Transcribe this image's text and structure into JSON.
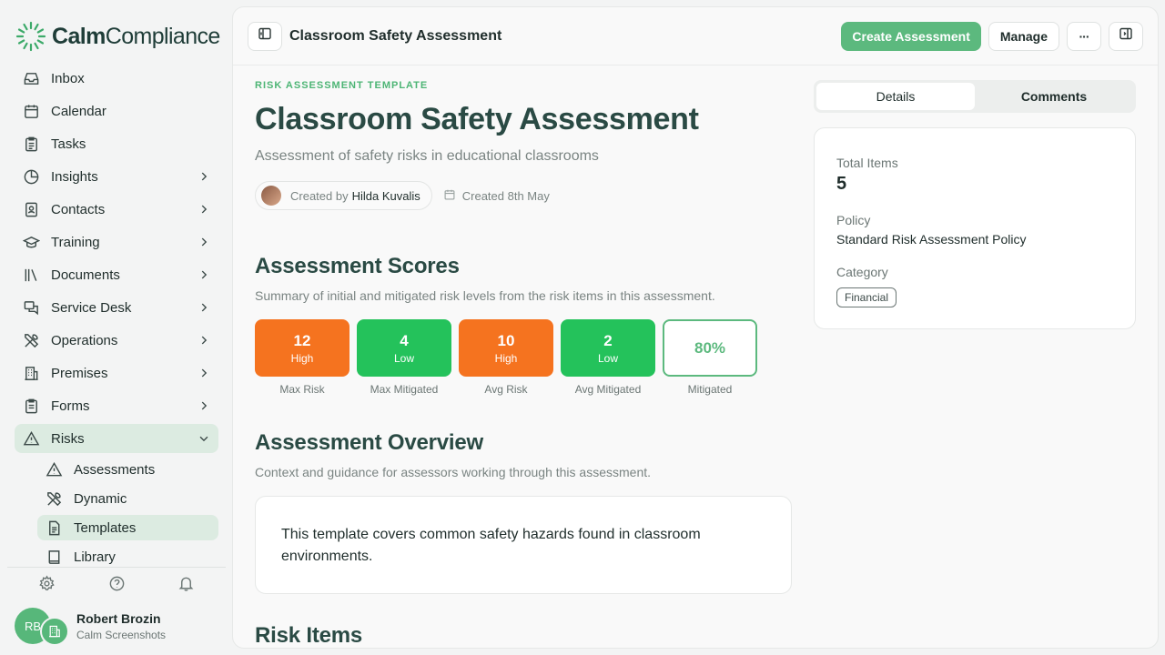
{
  "app": {
    "logo_bold": "Calm",
    "logo_light": "Compliance"
  },
  "sidebar": {
    "items": [
      {
        "label": "Inbox",
        "icon": "inbox-icon"
      },
      {
        "label": "Calendar",
        "icon": "calendar-icon"
      },
      {
        "label": "Tasks",
        "icon": "clipboard-icon"
      },
      {
        "label": "Insights",
        "icon": "pie-chart-icon"
      },
      {
        "label": "Contacts",
        "icon": "contact-book-icon"
      },
      {
        "label": "Training",
        "icon": "graduation-cap-icon"
      },
      {
        "label": "Documents",
        "icon": "library-icon"
      },
      {
        "label": "Service Desk",
        "icon": "chat-icon"
      },
      {
        "label": "Operations",
        "icon": "tools-icon"
      },
      {
        "label": "Premises",
        "icon": "building-icon"
      },
      {
        "label": "Forms",
        "icon": "clipboard-list-icon"
      },
      {
        "label": "Risks",
        "icon": "warning-icon"
      }
    ],
    "risk_sub": [
      {
        "label": "Assessments",
        "icon": "warning-icon"
      },
      {
        "label": "Dynamic",
        "icon": "tools-icon"
      },
      {
        "label": "Templates",
        "icon": "file-text-icon"
      },
      {
        "label": "Library",
        "icon": "book-icon"
      }
    ],
    "user": {
      "initials": "RB",
      "name": "Robert Brozin",
      "org": "Calm Screenshots"
    }
  },
  "topbar": {
    "title": "Classroom Safety Assessment",
    "create_label": "Create Assessment",
    "manage_label": "Manage",
    "more_label": "···"
  },
  "page": {
    "eyebrow": "RISK ASSESSMENT TEMPLATE",
    "title": "Classroom Safety Assessment",
    "description": "Assessment of safety risks in educational classrooms",
    "created_by_prefix": "Created by",
    "created_by_name": "Hilda Kuvalis",
    "created_date": "Created 8th May"
  },
  "scores": {
    "title": "Assessment Scores",
    "subtitle": "Summary of initial and mitigated risk levels from the risk items in this assessment.",
    "items": [
      {
        "value": "12",
        "level": "High",
        "caption": "Max Risk",
        "color": "#f5731f"
      },
      {
        "value": "4",
        "level": "Low",
        "caption": "Max Mitigated",
        "color": "#24c25b"
      },
      {
        "value": "10",
        "level": "High",
        "caption": "Avg Risk",
        "color": "#f5731f"
      },
      {
        "value": "2",
        "level": "Low",
        "caption": "Avg Mitigated",
        "color": "#24c25b"
      }
    ],
    "mitigated_pct": "80%",
    "mitigated_caption": "Mitigated"
  },
  "overview": {
    "title": "Assessment Overview",
    "subtitle": "Context and guidance for assessors working through this assessment.",
    "body": "This template covers common safety hazards found in classroom environments."
  },
  "risk_items": {
    "title": "Risk Items"
  },
  "details": {
    "tabs": [
      "Details",
      "Comments"
    ],
    "total_items_label": "Total Items",
    "total_items_value": "5",
    "policy_label": "Policy",
    "policy_value": "Standard Risk Assessment Policy",
    "category_label": "Category",
    "category_value": "Financial"
  },
  "colors": {
    "accent": "#5cb97e",
    "high": "#f5731f",
    "low": "#24c25b"
  }
}
